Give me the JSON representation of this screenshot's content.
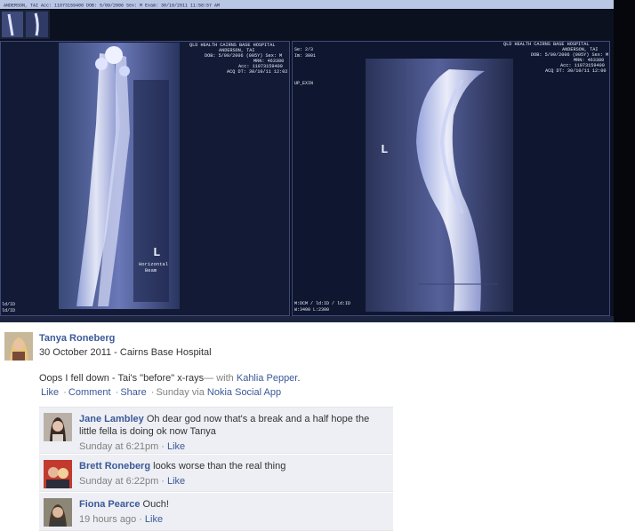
{
  "photo": {
    "top_bar_text": "ANDERSON, TAI   Acc: 11073159400   DOB: 5/09/2006   Sex: M   Exam: 30/10/2011 11:58:57 AM",
    "left_image": {
      "header_lines": [
        "QLD HEALTH CAIRNS BASE HOSPITAL",
        "ANDERSON, TAI",
        "DOB: 5/09/2006 (005Y) Sex: M",
        "MRN: 463380",
        "Acc: 11073159400",
        "ACQ DT: 30/10/11 12:02"
      ],
      "marker": "L",
      "caption_lines": [
        "Horizontal",
        "Beam"
      ],
      "bottom_left": [
        "ld/ID",
        "ld/ID"
      ]
    },
    "right_image": {
      "header_lines": [
        "QLD HEALTH CAIRNS BASE HOSPITAL",
        "ANDERSON, TAI",
        "DOB: 5/09/2006 (005Y) Sex: M",
        "MRN: 463380",
        "Acc: 11073159400",
        "ACQ DT: 30/10/11 12:00"
      ],
      "left_lines": [
        "Se: 2/3",
        "Im: 3001",
        "UP_EXIN"
      ],
      "marker": "L",
      "bottom_left": [
        "M:DCM / ld:ID / ld:ID",
        "W:3400 L:2300"
      ]
    }
  },
  "post": {
    "author": "Tanya Roneberg",
    "meta": "30 October 2011 - Cairns Base Hospital",
    "text": "Oops I fell down - Tai's \"before\" x-rays",
    "with_prefix": "— with ",
    "tagged": "Kahlia Pepper",
    "text_end": ".",
    "actions": {
      "like": "Like",
      "comment": "Comment",
      "share": "Share",
      "time_via": "Sunday via ",
      "app": "Nokia Social App",
      "separator": "·"
    }
  },
  "comments": [
    {
      "author": "Jane Lambley",
      "text": "Oh dear god now that's a break and a half hope the little fella is doing ok now Tanya",
      "time": "Sunday at 6:21pm",
      "like": "Like"
    },
    {
      "author": "Brett Roneberg",
      "text": "looks worse than the real thing",
      "time": "Sunday at 6:22pm",
      "like": "Like"
    },
    {
      "author": "Fiona Pearce",
      "text": "Ouch!",
      "time": "19 hours ago",
      "like": "Like"
    }
  ]
}
